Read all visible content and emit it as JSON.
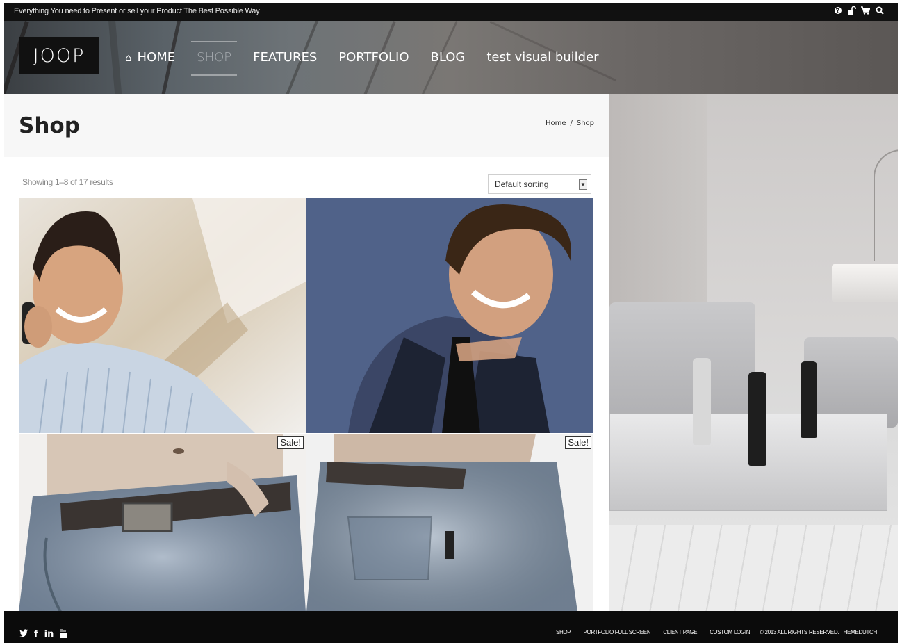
{
  "topbar": {
    "tagline": "Everything You need to Present or sell your Product The Best Possible Way",
    "icons": [
      "globe-icon",
      "unlock-icon",
      "cart-icon",
      "search-icon"
    ]
  },
  "header": {
    "logo": "JOOP",
    "nav": [
      {
        "label": "HOME",
        "icon": "home-icon"
      },
      {
        "label": "SHOP",
        "active": true
      },
      {
        "label": "FEATURES"
      },
      {
        "label": "PORTFOLIO"
      },
      {
        "label": "BLOG"
      },
      {
        "label": "test visual builder"
      }
    ]
  },
  "page": {
    "title": "Shop",
    "breadcrumb": {
      "home": "Home",
      "separator": "/",
      "current": "Shop"
    }
  },
  "shop": {
    "result_count": "Showing 1–8 of 17 results",
    "sorting": "Default sorting",
    "products": [
      {
        "sale": null
      },
      {
        "sale": null
      },
      {
        "sale": "Sale!"
      },
      {
        "sale": "Sale!"
      }
    ]
  },
  "footer": {
    "social": [
      "twitter-icon",
      "facebook-icon",
      "linkedin-icon",
      "youtube-icon"
    ],
    "social_text": {
      "facebook": "f",
      "linkedin": "in"
    },
    "menu": [
      "SHOP",
      "PORTFOLIO FULL SCREEN",
      "CLIENT PAGE",
      "CUSTOM LOGIN"
    ],
    "copyright": "© 2013 ALL RIGHTS RESERVED. THEMEDUTCH"
  }
}
